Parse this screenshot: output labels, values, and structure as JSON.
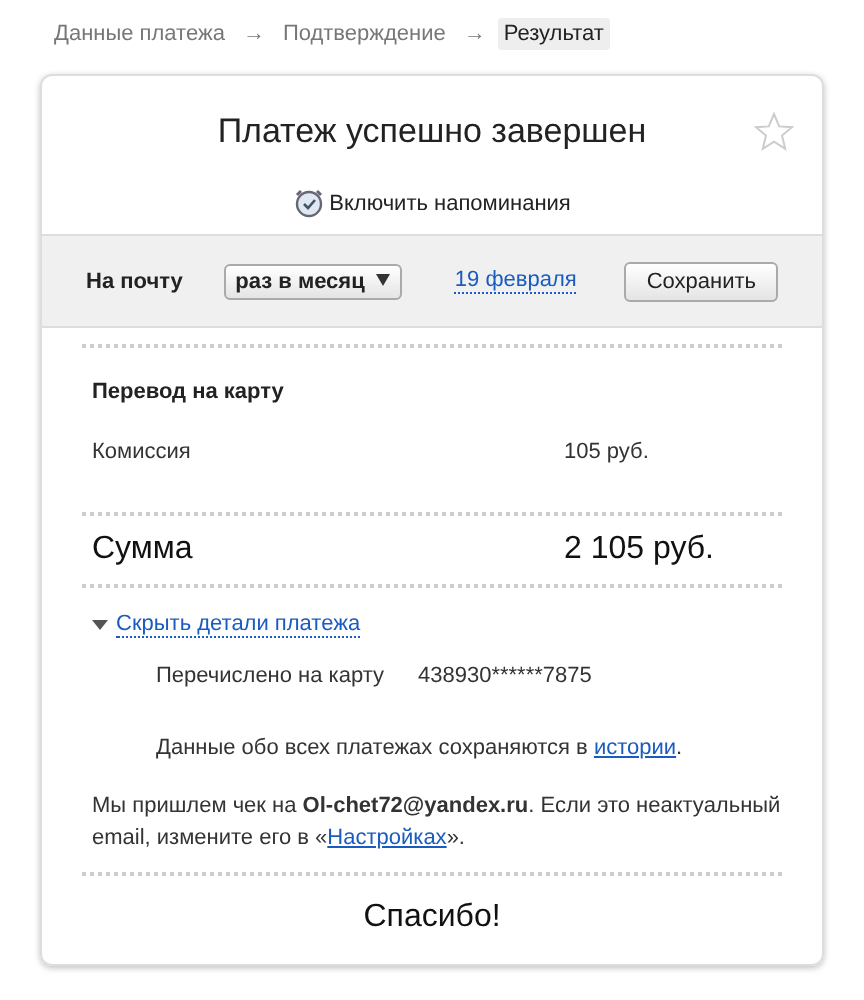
{
  "breadcrumbs": [
    {
      "label": "Данные платежа",
      "selected": false
    },
    {
      "label": "Подтверждение",
      "selected": false
    },
    {
      "label": "Результат",
      "selected": true
    }
  ],
  "breadcrumb_separator": "→",
  "title": "Платеж успешно завершен",
  "starred": false,
  "reminder_link": "Включить напоминания",
  "reminder": {
    "label": "На почту",
    "frequency": "раз в месяц",
    "date": "19 февраля",
    "save_button": "Сохранить"
  },
  "section_title": "Перевод на карту",
  "commission": {
    "label": "Комиссия",
    "value": "105 руб."
  },
  "total": {
    "label": "Сумма",
    "value": "2 105 руб."
  },
  "details": {
    "toggle": "Скрыть детали платежа",
    "expanded": true,
    "card_label": "Перечислено на карту",
    "card_number": "438930******7875"
  },
  "history_note": {
    "before": "Данные обо всех платежах сохраняются в ",
    "link": "истории",
    "after": "."
  },
  "receipt_note": {
    "before": "Мы пришлем чек на **Ol-chet72@yandex.ru**. Если это неактуальный email, измените его в «",
    "link": "Настройках",
    "after": "»."
  },
  "thanks": "Спасибо!"
}
